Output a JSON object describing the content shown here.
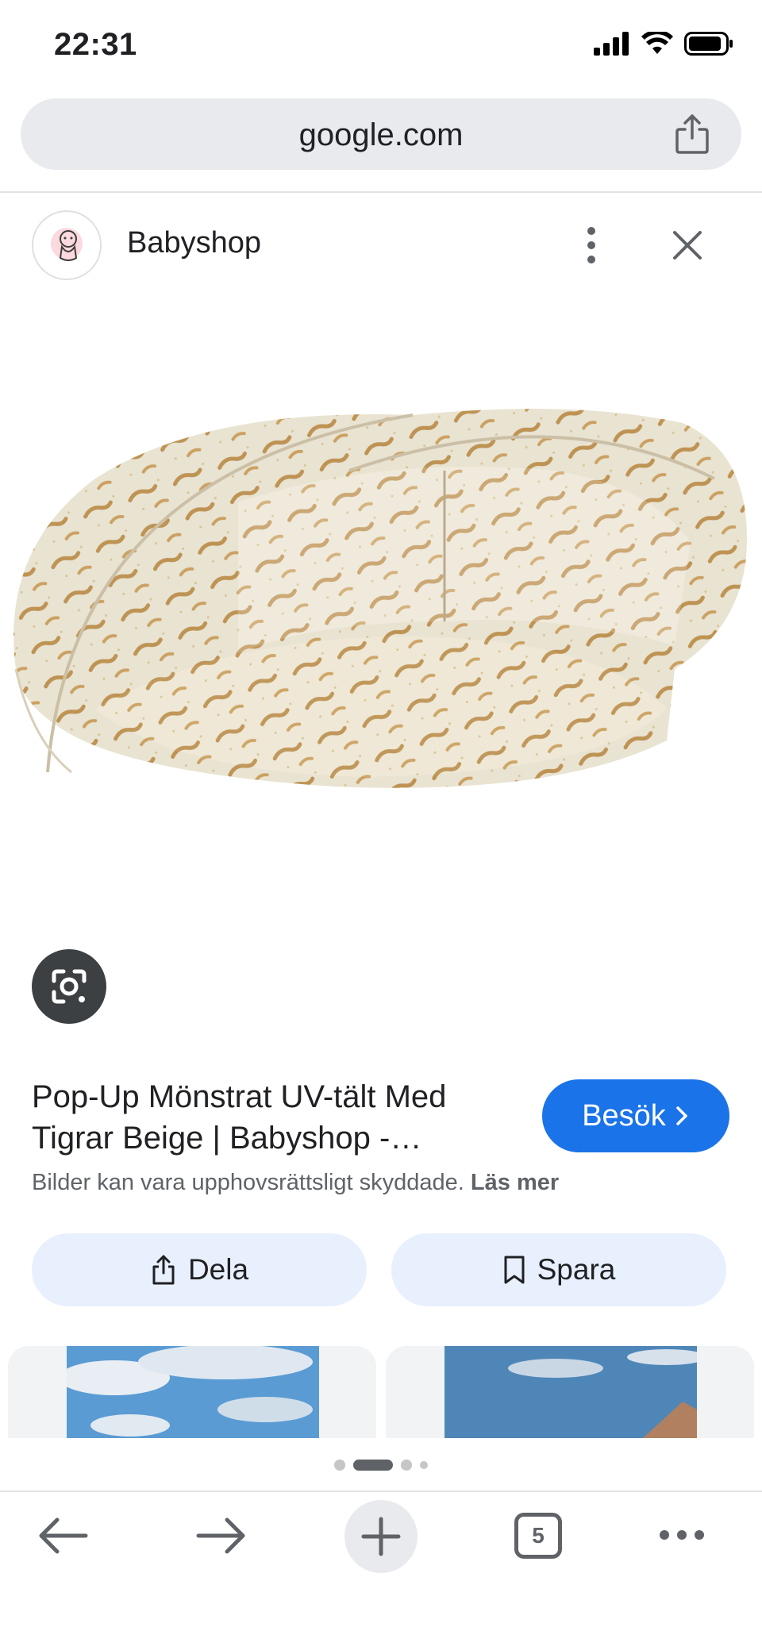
{
  "status": {
    "time": "22:31"
  },
  "browser": {
    "url": "google.com"
  },
  "source": {
    "name": "Babyshop"
  },
  "result": {
    "title": "Pop-Up Mönstrat UV-tält Med Tigrar Beige | Babyshop -…",
    "visit_label": "Besök",
    "copyright_text": "Bilder kan vara upphovsrättsligt skyddade.",
    "read_more_label": "Läs mer"
  },
  "actions": {
    "share_label": "Dela",
    "save_label": "Spara"
  },
  "pager": {
    "active_index": 1,
    "count": 4
  },
  "toolbar": {
    "tab_count": "5"
  },
  "colors": {
    "accent": "#1a73e8",
    "pill_bg": "#e8f0fe",
    "url_bar_bg": "#e8eaed"
  }
}
